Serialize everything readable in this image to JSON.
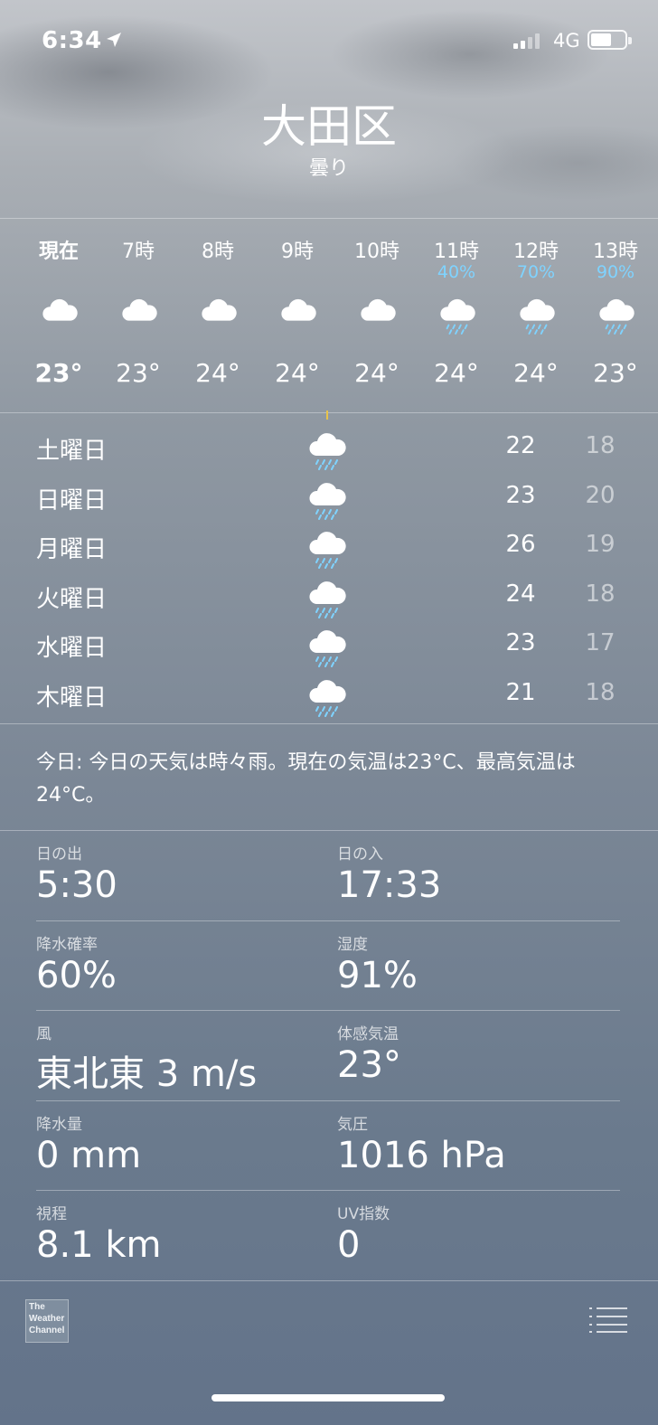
{
  "status": {
    "time": "6:34",
    "network": "4G",
    "battery_level": 0.6
  },
  "header": {
    "city": "大田区",
    "condition": "曇り"
  },
  "hourly": [
    {
      "label": "現在",
      "precip": "",
      "icon": "cloud-icon",
      "temp": "23°"
    },
    {
      "label": "7時",
      "precip": "",
      "icon": "cloud-icon",
      "temp": "23°"
    },
    {
      "label": "8時",
      "precip": "",
      "icon": "cloud-icon",
      "temp": "24°"
    },
    {
      "label": "9時",
      "precip": "",
      "icon": "cloud-icon",
      "temp": "24°"
    },
    {
      "label": "10時",
      "precip": "",
      "icon": "cloud-icon",
      "temp": "24°"
    },
    {
      "label": "11時",
      "precip": "40%",
      "icon": "cloud-rain-icon",
      "temp": "24°"
    },
    {
      "label": "12時",
      "precip": "70%",
      "icon": "cloud-rain-icon",
      "temp": "24°"
    },
    {
      "label": "13時",
      "precip": "90%",
      "icon": "cloud-rain-icon",
      "temp": "23°"
    }
  ],
  "daily": [
    {
      "day": "土曜日",
      "icon": "cloud-rain-icon",
      "high": "22",
      "low": "18"
    },
    {
      "day": "日曜日",
      "icon": "cloud-rain-icon",
      "high": "23",
      "low": "20"
    },
    {
      "day": "月曜日",
      "icon": "cloud-rain-icon",
      "high": "26",
      "low": "19"
    },
    {
      "day": "火曜日",
      "icon": "cloud-rain-icon",
      "high": "24",
      "low": "18"
    },
    {
      "day": "水曜日",
      "icon": "cloud-rain-icon",
      "high": "23",
      "low": "17"
    },
    {
      "day": "木曜日",
      "icon": "cloud-rain-icon",
      "high": "21",
      "low": "18"
    }
  ],
  "summary": "今日: 今日の天気は時々雨。現在の気温は23°C、最高気温は24°C。",
  "details": [
    {
      "key": "日の出",
      "value": "5:30"
    },
    {
      "key": "日の入",
      "value": "17:33"
    },
    {
      "key": "降水確率",
      "value": "60%"
    },
    {
      "key": "湿度",
      "value": "91%"
    },
    {
      "key": "風",
      "value": "東北東 3 m/s"
    },
    {
      "key": "体感気温",
      "value": "23°"
    },
    {
      "key": "降水量",
      "value": "0 mm"
    },
    {
      "key": "気圧",
      "value": "1016 hPa"
    },
    {
      "key": "視程",
      "value": "8.1 km"
    },
    {
      "key": "UV指数",
      "value": "0"
    }
  ],
  "footer": {
    "logo_lines": [
      "The",
      "Weather",
      "Channel"
    ],
    "list_icon": "list-icon"
  },
  "colors": {
    "precip": "#7fd3ff",
    "marker": "#e8c34a"
  }
}
